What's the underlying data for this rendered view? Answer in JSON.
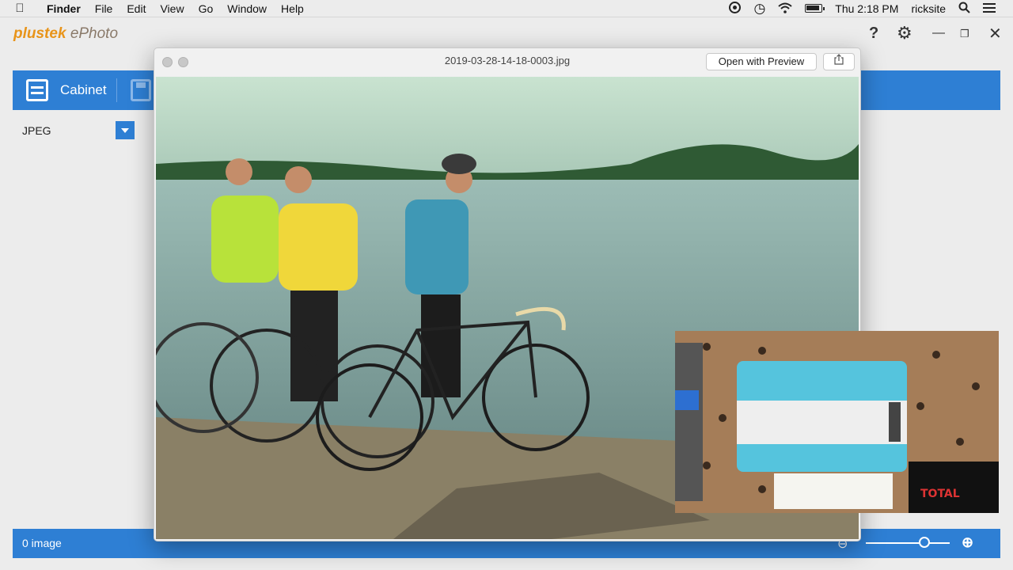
{
  "menubar": {
    "items": [
      "Finder",
      "File",
      "Edit",
      "View",
      "Go",
      "Window",
      "Help"
    ],
    "clock": "Thu 2:18 PM",
    "user": "ricksite"
  },
  "app": {
    "logo_brand": "plustek",
    "logo_product": "ePhoto",
    "toolbar": {
      "cabinet_label": "Cabinet"
    },
    "format": {
      "selected": "JPEG"
    },
    "status": {
      "count_text": "0 image"
    },
    "zoom": {
      "level": 0.7
    },
    "accent_color": "#2e7fd4"
  },
  "quicklook": {
    "title": "2019-03-28-14-18-0003.jpg",
    "open_button": "Open with Preview"
  }
}
